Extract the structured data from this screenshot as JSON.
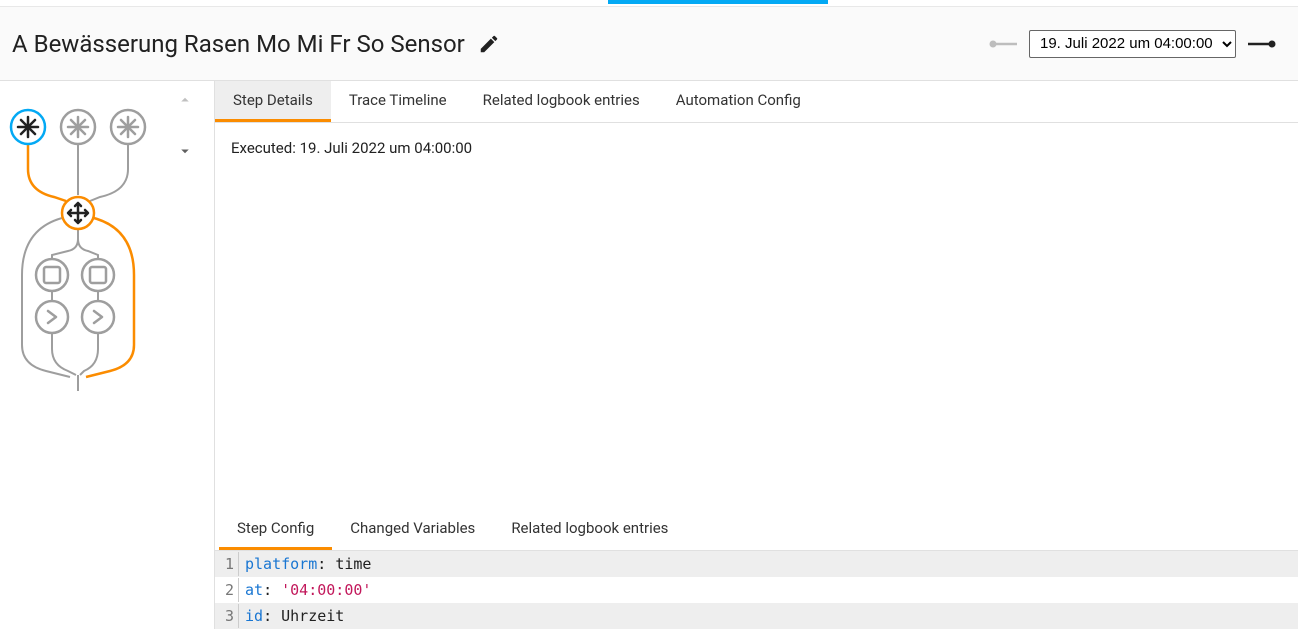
{
  "header": {
    "title": "A Bewässerung Rasen Mo Mi Fr So Sensor",
    "run_selected": "19. Juli 2022 um 04:00:00"
  },
  "tabs_upper": {
    "items": [
      {
        "label": "Step Details",
        "active": true
      },
      {
        "label": "Trace Timeline",
        "active": false
      },
      {
        "label": "Related logbook entries",
        "active": false
      },
      {
        "label": "Automation Config",
        "active": false
      }
    ]
  },
  "step_details": {
    "executed_prefix": "Executed: ",
    "executed_time": "19. Juli 2022 um 04:00:00"
  },
  "tabs_lower": {
    "items": [
      {
        "label": "Step Config",
        "active": true
      },
      {
        "label": "Changed Variables",
        "active": false
      },
      {
        "label": "Related logbook entries",
        "active": false
      }
    ]
  },
  "step_config": {
    "lines": [
      {
        "n": "1",
        "key": "platform",
        "colon": ": ",
        "val": "time",
        "val_is_string": false
      },
      {
        "n": "2",
        "key": "at",
        "colon": ": ",
        "val": "'04:00:00'",
        "val_is_string": true
      },
      {
        "n": "3",
        "key": "id",
        "colon": ": ",
        "val": "Uhrzeit",
        "val_is_string": false
      }
    ]
  },
  "graph": {
    "active_color": "#03a9f4",
    "path_color": "#fb8c00",
    "idle_color": "#9e9e9e"
  }
}
